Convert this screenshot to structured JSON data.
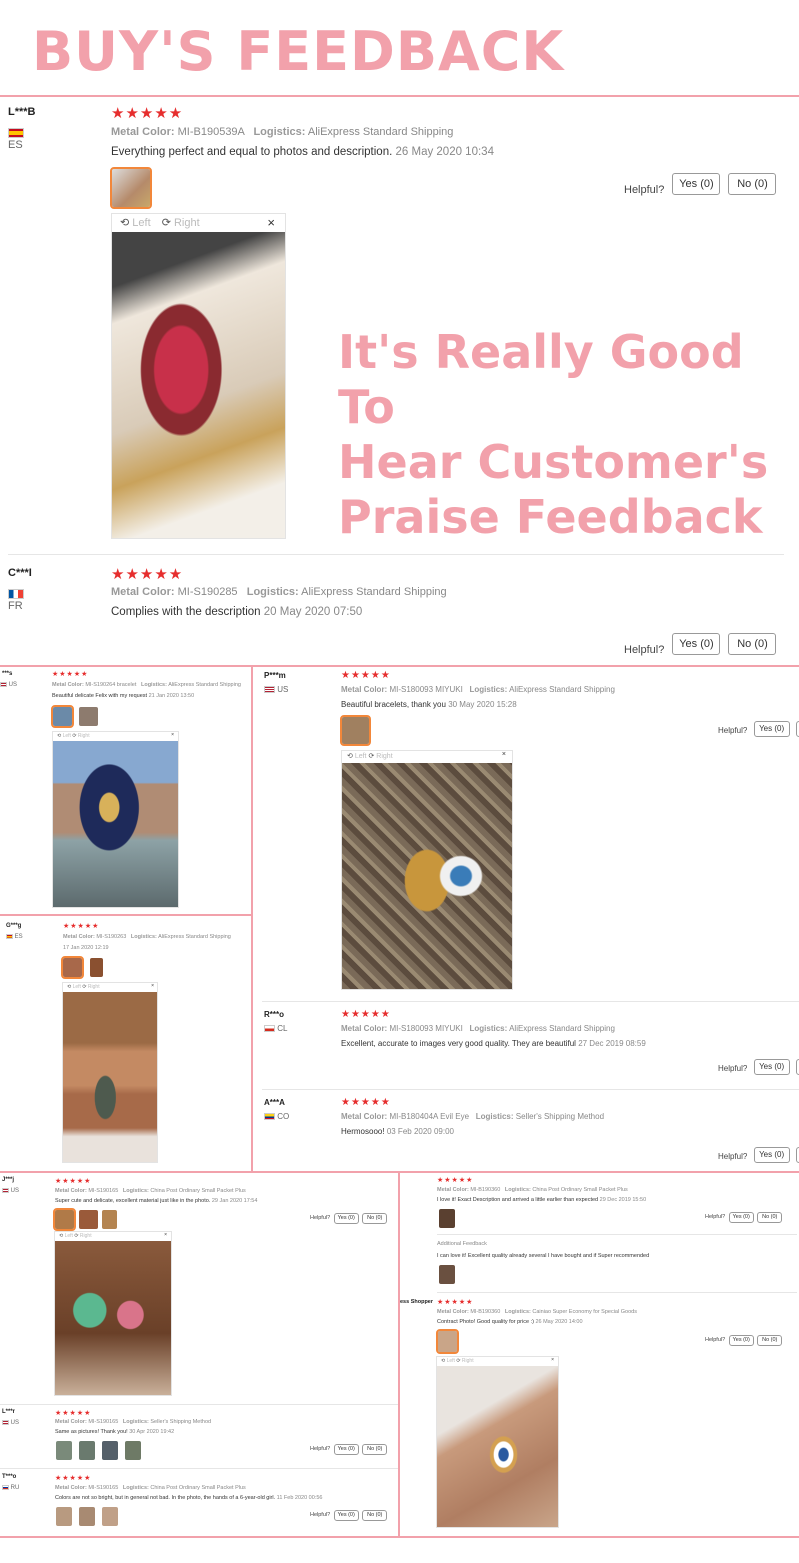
{
  "page": {
    "title": "BUY'S FEEDBACK",
    "slogan_1": "It's Really Good To",
    "slogan_2": "Hear Customer's",
    "slogan_3": "Praise Feedback"
  },
  "ui": {
    "stars": "★★★★★",
    "helpful": "Helpful?",
    "yes": "Yes (0)",
    "no": "No (0)",
    "left": "Left",
    "right": "Right",
    "close": "×",
    "metal_label": "Metal Color:",
    "logistics_label": "Logistics:"
  },
  "reviews": {
    "r1": {
      "user": "L***B",
      "country": "ES",
      "metal": "MI-B190539A",
      "logistics": "AliExpress Standard Shipping",
      "text": "Everything perfect and equal to photos and description.",
      "date": "26 May 2020 10:34"
    },
    "r2": {
      "user": "C***I",
      "country": "FR",
      "metal": "MI-S190285",
      "logistics": "AliExpress Standard Shipping",
      "text": "Complies with the description",
      "date": "20 May 2020 07:50"
    },
    "r3": {
      "user": "***s",
      "country": "US",
      "metal": "MI-S190264 bracelet",
      "logistics": "AliExpress Standard Shipping",
      "text": "Beautiful delicate Felix with my request",
      "date": "21 Jan 2020 13:50"
    },
    "r4": {
      "user": "G***g",
      "country": "ES",
      "metal": "MI-S190263",
      "logistics": "AliExpress Standard Shipping",
      "text": "",
      "date": "17 Jan 2020 12:19"
    },
    "r5": {
      "user": "P***m",
      "country": "US",
      "metal": "MI-S180093 MIYUKI",
      "logistics": "AliExpress Standard Shipping",
      "text": "Beautiful bracelets, thank you",
      "date": "30 May 2020 15:28"
    },
    "r6": {
      "user": "R***o",
      "country": "CL",
      "metal": "MI-S180093 MIYUKI",
      "logistics": "AliExpress Standard Shipping",
      "text": "Excellent, accurate to images very good quality. They are beautiful",
      "date": "27 Dec 2019 08:59"
    },
    "r7": {
      "user": "A***A",
      "country": "CO",
      "metal": "MI-B180404A Evil Eye",
      "logistics": "Seller's Shipping Method",
      "text": "Hermosooo!",
      "date": "03 Feb 2020 09:00"
    },
    "r8": {
      "user": "J***j",
      "country": "US",
      "metal": "MI-S190165",
      "logistics": "China Post Ordinary Small Packet Plus",
      "text": "Super cute and delicate, excellent material just like in the photo.",
      "date": "29 Jan 2020 17:54"
    },
    "r9": {
      "user": "L***r",
      "country": "US",
      "metal": "MI-S190165",
      "logistics": "Seller's Shipping Method",
      "text": "Same as pictures! Thank you!",
      "date": "30 Apr 2020 19:42"
    },
    "r10": {
      "user": "T***o",
      "country": "RU",
      "metal": "MI-S190165",
      "logistics": "China Post Ordinary Small Packet Plus",
      "text": "Colors are not so bright, but in general not bad. In the photo, the hands of a 6-year-old girl.",
      "date": "11 Feb 2020 00:56"
    },
    "r11": {
      "user": "",
      "country": "",
      "metal": "MI-B190360",
      "logistics": "China Post Ordinary Small Packet Plus",
      "text": "I love it! Exact Description and arrived a little earlier than expected",
      "date": "29 Dec 2019 15:50",
      "additional_label": "Additional Feedback",
      "additional_text": "I can love it! Excellent quality already several I have bought and if Super recommended"
    },
    "r12": {
      "user": "ess Shopper",
      "country": "",
      "metal": "MI-B190360",
      "logistics": "Cainiao Super Economy for Special Goods",
      "text": "Contract Photo! Good quality for price :)",
      "date": "26 May 2020 14:00"
    }
  },
  "colors": {
    "accent": "#f2a1ab",
    "stars": "#e62e2e",
    "selected_thumb": "#f2873a"
  }
}
